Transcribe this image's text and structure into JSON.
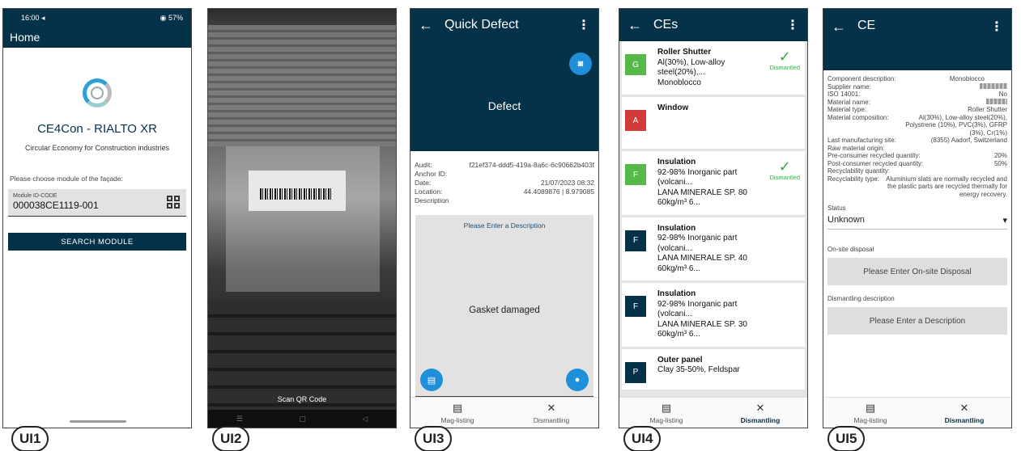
{
  "labels": [
    "UI1",
    "UI2",
    "UI3",
    "UI4",
    "UI5"
  ],
  "ui1": {
    "status_time": "16:00 ◂",
    "status_right": "◉ 57%",
    "appbar_title": "Home",
    "app_title": "CE4Con - RIALTO XR",
    "app_subtitle": "Circular Economy for Construction industries",
    "prompt": "Please choose module of the façade:",
    "field_label": "Module ID-CODE",
    "field_value": "000038CE1119-001",
    "search_button": "SEARCH MODULE"
  },
  "ui2": {
    "scan_text": "Scan QR Code"
  },
  "ui3": {
    "title": "Quick Defect",
    "header_text": "Defect",
    "meta": [
      {
        "k": "Audit:",
        "v": "f21ef374-ddd5-419a-8a6c-6c90662b403f"
      },
      {
        "k": "Anchor ID:",
        "v": ""
      },
      {
        "k": "Date:",
        "v": "21/07/2023 08:32"
      },
      {
        "k": "Location:",
        "v": "44.4089876 | 8.979085"
      },
      {
        "k": "Description",
        "v": ""
      }
    ],
    "desc_placeholder": "Please Enter a Description",
    "desc_value": "Gasket damaged",
    "tab_left": "Mag-listing",
    "tab_right": "Dismantling"
  },
  "ui4": {
    "title": "CEs",
    "items": [
      {
        "badge": "G",
        "color": "#55b948",
        "name": "Roller Shutter",
        "lines": [
          "Al(30%), Low-alloy",
          "steel(20%),...",
          "Monoblocco"
        ],
        "status": "Dismantled"
      },
      {
        "badge": "A",
        "color": "#d33b3b",
        "name": "Window",
        "lines": [],
        "status": ""
      },
      {
        "badge": "F",
        "color": "#55b948",
        "name": "Insulation",
        "lines": [
          "92-98% Inorganic part",
          "(volcani...",
          "LANA MINERALE SP. 80",
          "60kg/m³ 6..."
        ],
        "status": "Dismantled"
      },
      {
        "badge": "F",
        "color": "#063249",
        "name": "Insulation",
        "lines": [
          "92-98% Inorganic part",
          "(volcani...",
          "LANA MINERALE SP. 40",
          "60kg/m³ 6..."
        ],
        "status": ""
      },
      {
        "badge": "F",
        "color": "#063249",
        "name": "Insulation",
        "lines": [
          "92-98% Inorganic part",
          "(volcani...",
          "LANA MINERALE SP. 30",
          "60kg/m³ 6..."
        ],
        "status": ""
      },
      {
        "badge": "P",
        "color": "#063249",
        "name": "Outer panel",
        "lines": [
          "Clay 35-50%, Feldspar"
        ],
        "status": ""
      }
    ],
    "tab_left": "Mag-listing",
    "tab_right": "Dismantling"
  },
  "ui5": {
    "title": "CE",
    "details": [
      {
        "k": "Component description:",
        "v": "Monoblocco"
      },
      {
        "k": "Supplier name:",
        "v": ""
      },
      {
        "k": "ISO 14001:",
        "v": "No"
      },
      {
        "k": "Material name:",
        "v": ""
      },
      {
        "k": "Material type:",
        "v": "Roller Shutter"
      },
      {
        "k": "Material composition:",
        "v": "Al(30%), Low-alloy steel(20%), Polystrene (10%), PVC(3%), GFRP (3%), Cr(1%)"
      },
      {
        "k": "Last manufacturing site:",
        "v": "(8355) Aadorf, Switzerland"
      },
      {
        "k": "Raw material origin:",
        "v": ""
      },
      {
        "k": "Pre-consumer recycled quantity:",
        "v": "20%"
      },
      {
        "k": "Post-consumer recycled quantity:",
        "v": "50%"
      },
      {
        "k": "Recyclability quantity:",
        "v": ""
      },
      {
        "k": "Recyclability type:",
        "v": "Aluminium slats are normally recycled and the plastic parts are recycled thermally for energy recovery."
      }
    ],
    "status_label": "Status",
    "status_value": "Unknown",
    "onsite_label": "On-site disposal",
    "onsite_placeholder": "Please Enter On-site Disposal",
    "dismantle_label": "Dismantling description",
    "dismantle_placeholder": "Please Enter a Description",
    "tab_left": "Mag-listing",
    "tab_right": "Dismantling"
  }
}
